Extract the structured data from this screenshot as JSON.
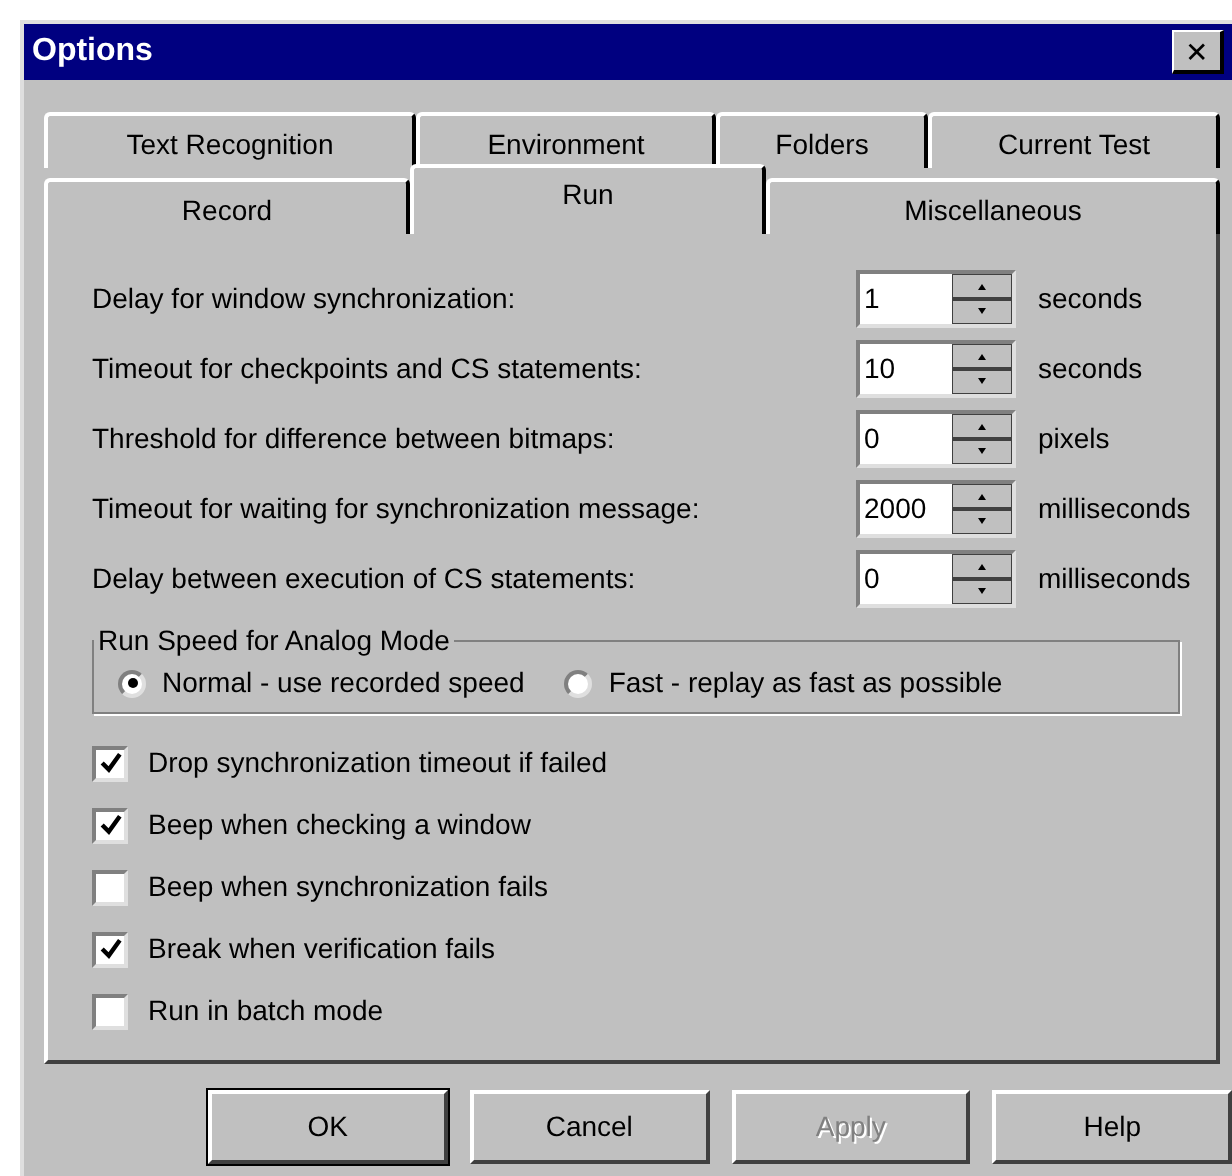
{
  "window": {
    "title": "Options",
    "close": "✕"
  },
  "tab_rows": [
    {
      "tabs": [
        {
          "label": "Text Recognition",
          "selected": false
        },
        {
          "label": "Environment",
          "selected": false
        },
        {
          "label": "Folders",
          "selected": false
        },
        {
          "label": "Current Test",
          "selected": false
        }
      ]
    },
    {
      "tabs": [
        {
          "label": "Record",
          "selected": false
        },
        {
          "label": "Run",
          "selected": true
        },
        {
          "label": "Miscellaneous",
          "selected": false
        }
      ]
    }
  ],
  "settings": [
    {
      "label": "Delay for window synchronization:",
      "value": "1",
      "unit": "seconds"
    },
    {
      "label": "Timeout for checkpoints and CS statements:",
      "value": "10",
      "unit": "seconds"
    },
    {
      "label": "Threshold for difference between bitmaps:",
      "value": "0",
      "unit": "pixels"
    },
    {
      "label": "Timeout for waiting for synchronization message:",
      "value": "2000",
      "unit": "milliseconds"
    },
    {
      "label": "Delay between execution of CS statements:",
      "value": "0",
      "unit": "milliseconds"
    }
  ],
  "run_speed": {
    "title": "Run Speed for Analog Mode",
    "options": [
      {
        "label": "Normal - use recorded speed",
        "selected": true
      },
      {
        "label": "Fast - replay as fast as possible",
        "selected": false
      }
    ]
  },
  "checkboxes": [
    {
      "label": "Drop synchronization timeout if failed",
      "checked": true
    },
    {
      "label": "Beep when checking a window",
      "checked": true
    },
    {
      "label": "Beep when synchronization fails",
      "checked": false
    },
    {
      "label": "Break when verification fails",
      "checked": true
    },
    {
      "label": "Run in batch mode",
      "checked": false
    }
  ],
  "buttons": [
    {
      "label": "OK",
      "kind": "default",
      "disabled": false
    },
    {
      "label": "Cancel",
      "kind": "normal",
      "disabled": false
    },
    {
      "label": "Apply",
      "kind": "normal",
      "disabled": true
    },
    {
      "label": "Help",
      "kind": "normal",
      "disabled": false
    }
  ]
}
